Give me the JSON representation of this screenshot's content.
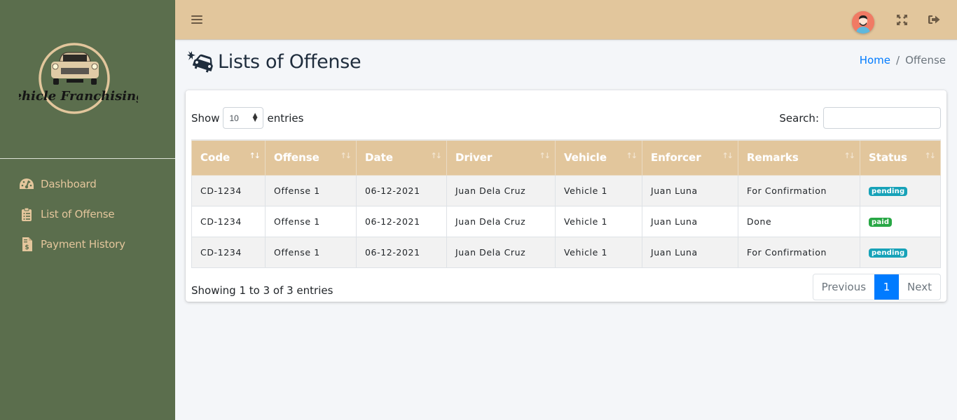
{
  "app": {
    "brand_name": "Vehicle Franchising"
  },
  "sidebar": {
    "items": [
      {
        "label": "Dashboard",
        "icon": "tachometer-icon"
      },
      {
        "label": "List of Offense",
        "icon": "clipboard-list-icon"
      },
      {
        "label": "Payment History",
        "icon": "file-invoice-dollar-icon"
      }
    ]
  },
  "topbar": {
    "menu_icon": "hamburger-icon",
    "avatar_icon": "user-avatar-icon",
    "fullscreen_icon": "expand-arrows-icon",
    "logout_icon": "sign-out-icon"
  },
  "header": {
    "title": "Lists of Offense",
    "title_icon": "car-crash-icon",
    "breadcrumb": {
      "home": "Home",
      "separator": "/",
      "current": "Offense"
    }
  },
  "datatable": {
    "length_prefix": "Show",
    "length_value": "10",
    "length_suffix": "entries",
    "search_label": "Search:",
    "search_value": "",
    "columns": [
      "Code",
      "Offense",
      "Date",
      "Driver",
      "Vehicle",
      "Enforcer",
      "Remarks",
      "Status"
    ],
    "rows": [
      {
        "code": "CD-1234",
        "offense": "Offense 1",
        "date": "06-12-2021",
        "driver": "Juan Dela Cruz",
        "vehicle": "Vehicle 1",
        "enforcer": "Juan Luna",
        "remarks": "For Confirmation",
        "status": "pending"
      },
      {
        "code": "CD-1234",
        "offense": "Offense 1",
        "date": "06-12-2021",
        "driver": "Juan Dela Cruz",
        "vehicle": "Vehicle 1",
        "enforcer": "Juan Luna",
        "remarks": "Done",
        "status": "paid"
      },
      {
        "code": "CD-1234",
        "offense": "Offense 1",
        "date": "06-12-2021",
        "driver": "Juan Dela Cruz",
        "vehicle": "Vehicle 1",
        "enforcer": "Juan Luna",
        "remarks": "For Confirmation",
        "status": "pending"
      }
    ],
    "info": "Showing 1 to 3 of 3 entries",
    "pagination": {
      "previous": "Previous",
      "current": "1",
      "next": "Next"
    }
  },
  "colors": {
    "sidebar_bg": "#5b6e4d",
    "accent_tan": "#e2c69c",
    "status_pending": "#17a2b8",
    "status_paid": "#28a745",
    "primary": "#007bff"
  }
}
